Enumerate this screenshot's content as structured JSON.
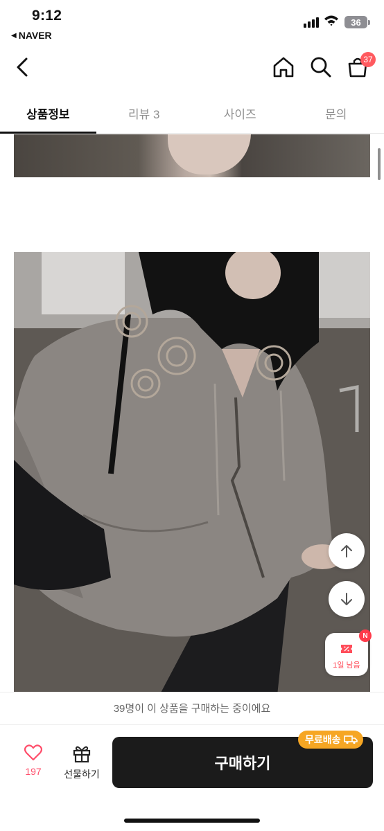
{
  "status_bar": {
    "time": "9:12",
    "back_app": "NAVER",
    "battery": "36"
  },
  "nav": {
    "cart_count": "37"
  },
  "tabs": [
    {
      "label": "상품정보",
      "active": true
    },
    {
      "label": "리뷰 3",
      "active": false
    },
    {
      "label": "사이즈",
      "active": false
    },
    {
      "label": "문의",
      "active": false
    }
  ],
  "floating": {
    "coupon_label": "1일 남음",
    "coupon_badge": "N"
  },
  "banner": {
    "text": "39명이 이 상품을 구매하는 중이에요"
  },
  "bottom_bar": {
    "like_count": "197",
    "gift_label": "선물하기",
    "buy_label": "구매하기",
    "shipping_badge": "무료배송"
  },
  "colors": {
    "accent_red": "#ff4d6a",
    "buy_button": "#1b1b1b",
    "shipping_badge": "#f6a623"
  }
}
